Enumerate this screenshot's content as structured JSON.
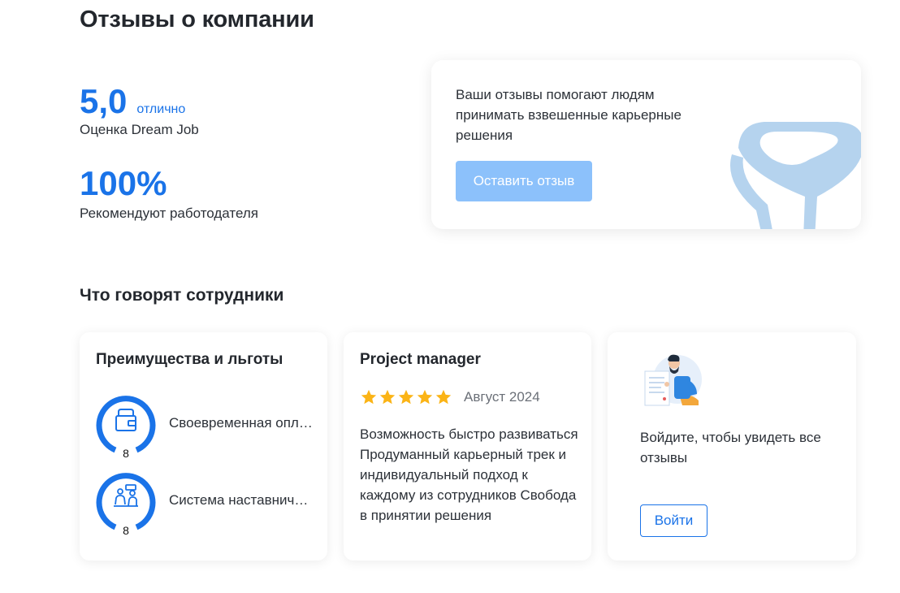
{
  "page": {
    "title": "Отзывы о компании"
  },
  "rating": {
    "score": "5,0",
    "score_word": "отлично",
    "score_label": "Оценка Dream Job",
    "recommend_value": "100%",
    "recommend_label": "Рекомендуют работодателя"
  },
  "cta": {
    "text": "Ваши отзывы помогают людям принимать взвешенные карьерные решения",
    "button_label": "Оставить отзыв",
    "button_color": "#8cc1fb"
  },
  "section": {
    "title": "Что говорят сотрудники"
  },
  "benefits_card": {
    "title": "Преимущества и льготы",
    "items": [
      {
        "icon": "wallet-icon",
        "label": "Своевременная оплата труда",
        "count": "8"
      },
      {
        "icon": "mentoring-icon",
        "label": "Система наставничества",
        "count": "8"
      }
    ]
  },
  "review_card": {
    "title": "Project manager",
    "rating": 5,
    "date": "Август 2024",
    "text": "Возможность быстро развиваться Продуманный карьерный трек и индивидуальный подход к каждому из сотрудников Свобода в принятии решения"
  },
  "login_card": {
    "text": "Войдите, чтобы увидеть все отзывы",
    "button_label": "Войти",
    "illustration": "person-with-document-illustration"
  },
  "colors": {
    "accent": "#1a73e8",
    "star": "#fbb416",
    "logo": "#b5d3ee"
  }
}
